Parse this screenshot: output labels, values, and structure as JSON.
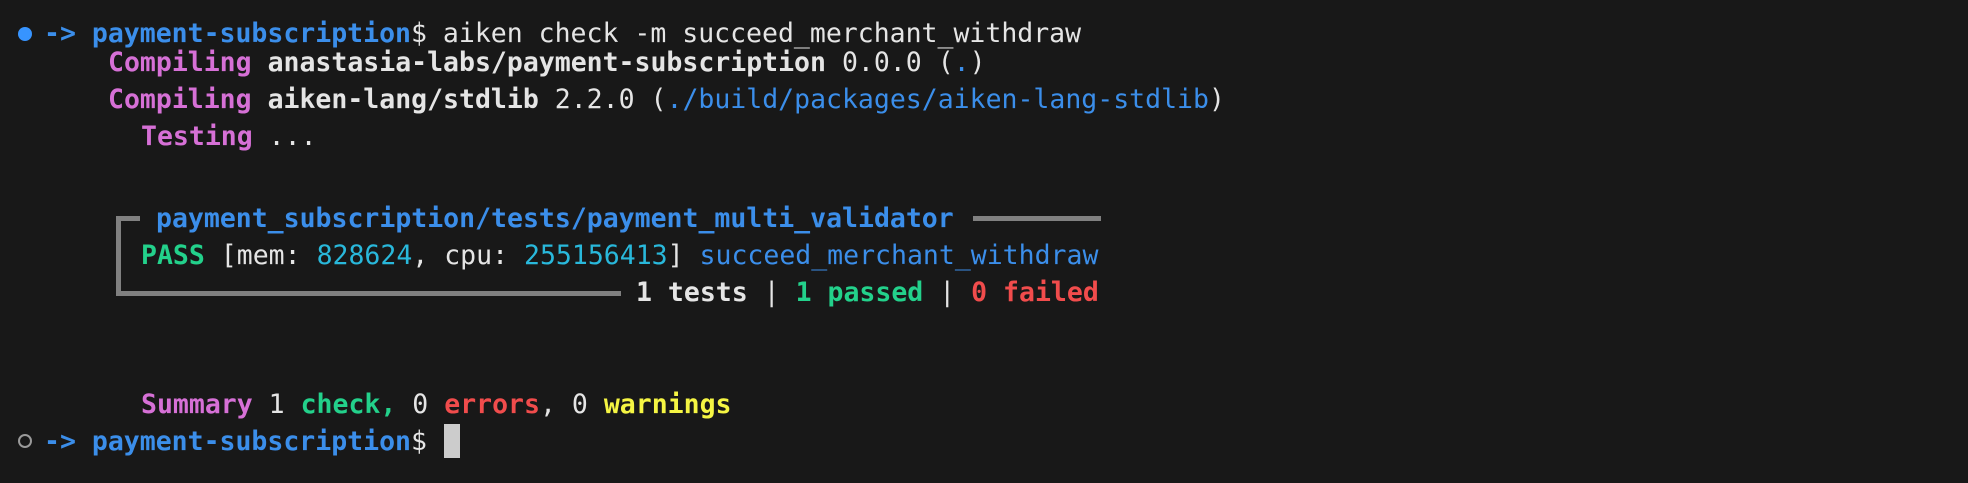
{
  "prompt": {
    "arrow": "->",
    "cwd": "payment-subscription",
    "symbol": "$",
    "command": "aiken check -m succeed_merchant_withdraw"
  },
  "compile": [
    {
      "label": "Compiling",
      "pkg": "anastasia-labs/payment-subscription",
      "version": "0.0.0",
      "path": "."
    },
    {
      "label": "Compiling",
      "pkg": "aiken-lang/stdlib",
      "version": "2.2.0",
      "path": "./build/packages/aiken-lang-stdlib"
    }
  ],
  "testing": {
    "label": "Testing",
    "ellipsis": "..."
  },
  "module": {
    "name": "payment_subscription/tests/payment_multi_validator",
    "test": {
      "status": "PASS",
      "mem_label": "mem:",
      "mem": "828624",
      "cpu_label": "cpu:",
      "cpu": "255156413",
      "name": "succeed_merchant_withdraw"
    },
    "totals": {
      "tests": "1 tests",
      "sep": "|",
      "passed": "1 passed",
      "failed": "0 failed"
    }
  },
  "summary": {
    "label": "Summary",
    "checks_count": "1",
    "checks_label": "check,",
    "errors_count": "0",
    "errors_label": "errors",
    "comma": ",",
    "warnings_count": "0",
    "warnings_label": "warnings"
  },
  "prompt2": {
    "arrow": "->",
    "cwd": "payment-subscription",
    "symbol": "$"
  },
  "colors": {
    "background": "#181818",
    "blue": "#3b8eea",
    "cyan": "#29b8db",
    "magenta": "#d670d6",
    "green": "#23d18b",
    "red": "#f14c4c",
    "yellow": "#f5f543"
  }
}
